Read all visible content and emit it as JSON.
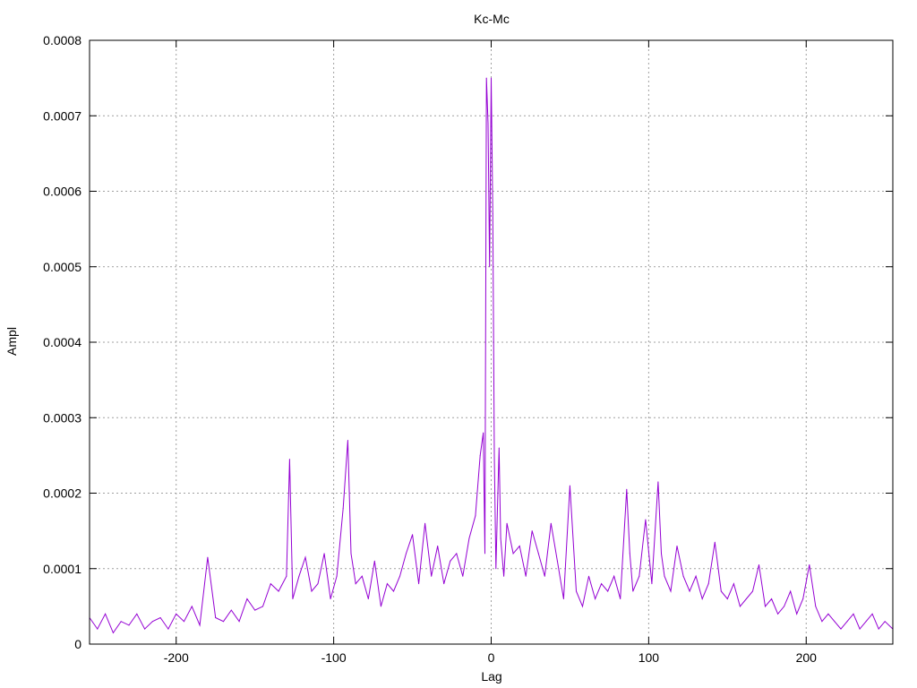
{
  "chart_data": {
    "type": "line",
    "title": "Kc-Mc",
    "xlabel": "Lag",
    "ylabel": "Ampl",
    "xlim": [
      -255,
      255
    ],
    "ylim": [
      0,
      0.0008
    ],
    "xticks": [
      -200,
      -100,
      0,
      100,
      200
    ],
    "xtick_labels": [
      "-200",
      "-100",
      "0",
      "100",
      "200"
    ],
    "yticks": [
      0,
      0.0001,
      0.0002,
      0.0003,
      0.0004,
      0.0005,
      0.0006,
      0.0007,
      0.0008
    ],
    "ytick_labels": [
      "0",
      "0.0001",
      "0.0002",
      "0.0003",
      "0.0004",
      "0.0005",
      "0.0006",
      "0.0007",
      "0.0008"
    ],
    "grid": true,
    "legend": "none",
    "series_color": "#9400d3",
    "series": [
      {
        "x": [
          -255,
          -250,
          -245,
          -240,
          -235,
          -230,
          -225,
          -220,
          -215,
          -210,
          -205,
          -200,
          -195,
          -190,
          -185,
          -180,
          -175,
          -170,
          -165,
          -160,
          -155,
          -150,
          -145,
          -140,
          -135,
          -130,
          -128,
          -126,
          -122,
          -118,
          -114,
          -110,
          -106,
          -102,
          -98,
          -94,
          -91,
          -89,
          -86,
          -82,
          -78,
          -74,
          -70,
          -66,
          -62,
          -58,
          -54,
          -50,
          -46,
          -42,
          -38,
          -34,
          -30,
          -26,
          -22,
          -18,
          -14,
          -10,
          -7,
          -5,
          -4,
          -3,
          -2,
          -1,
          0,
          1,
          2,
          3,
          4,
          5,
          6,
          8,
          10,
          14,
          18,
          22,
          26,
          30,
          34,
          38,
          42,
          46,
          50,
          54,
          58,
          62,
          66,
          70,
          74,
          78,
          82,
          86,
          88,
          90,
          94,
          98,
          102,
          106,
          108,
          110,
          114,
          118,
          122,
          126,
          130,
          134,
          138,
          142,
          146,
          150,
          154,
          158,
          162,
          166,
          170,
          174,
          178,
          182,
          186,
          190,
          194,
          198,
          202,
          206,
          210,
          214,
          218,
          222,
          226,
          230,
          234,
          238,
          242,
          246,
          250,
          255
        ],
        "y": [
          3.5e-05,
          2e-05,
          4e-05,
          1.5e-05,
          3e-05,
          2.5e-05,
          4e-05,
          2e-05,
          3e-05,
          3.5e-05,
          2e-05,
          4e-05,
          3e-05,
          5e-05,
          2.5e-05,
          0.000115,
          3.5e-05,
          3e-05,
          4.5e-05,
          3e-05,
          6e-05,
          4.5e-05,
          5e-05,
          8e-05,
          7e-05,
          9e-05,
          0.000245,
          6e-05,
          9e-05,
          0.000115,
          7e-05,
          8e-05,
          0.00012,
          6e-05,
          9e-05,
          0.00018,
          0.00027,
          0.00012,
          8e-05,
          9e-05,
          6e-05,
          0.00011,
          5e-05,
          8e-05,
          7e-05,
          9e-05,
          0.00012,
          0.000145,
          8e-05,
          0.00016,
          9e-05,
          0.00013,
          8e-05,
          0.00011,
          0.00012,
          9e-05,
          0.00014,
          0.00017,
          0.00025,
          0.00028,
          0.00012,
          0.00075,
          0.00069,
          0.0005,
          0.00075,
          0.00057,
          0.00025,
          0.0001,
          0.00018,
          0.00026,
          0.00014,
          9e-05,
          0.00016,
          0.00012,
          0.00013,
          9e-05,
          0.00015,
          0.00012,
          9e-05,
          0.00016,
          0.00011,
          6e-05,
          0.00021,
          7e-05,
          5e-05,
          9e-05,
          6e-05,
          8e-05,
          7e-05,
          9e-05,
          6e-05,
          0.000205,
          0.00012,
          7e-05,
          9e-05,
          0.000165,
          8e-05,
          0.000215,
          0.00012,
          9e-05,
          7e-05,
          0.00013,
          9e-05,
          7e-05,
          9e-05,
          6e-05,
          8e-05,
          0.000135,
          7e-05,
          6e-05,
          8e-05,
          5e-05,
          6e-05,
          7e-05,
          0.000105,
          5e-05,
          6e-05,
          4e-05,
          5e-05,
          7e-05,
          4e-05,
          6e-05,
          0.000105,
          5e-05,
          3e-05,
          4e-05,
          3e-05,
          2e-05,
          3e-05,
          4e-05,
          2e-05,
          3e-05,
          4e-05,
          2e-05,
          3e-05,
          2e-05
        ]
      }
    ]
  }
}
